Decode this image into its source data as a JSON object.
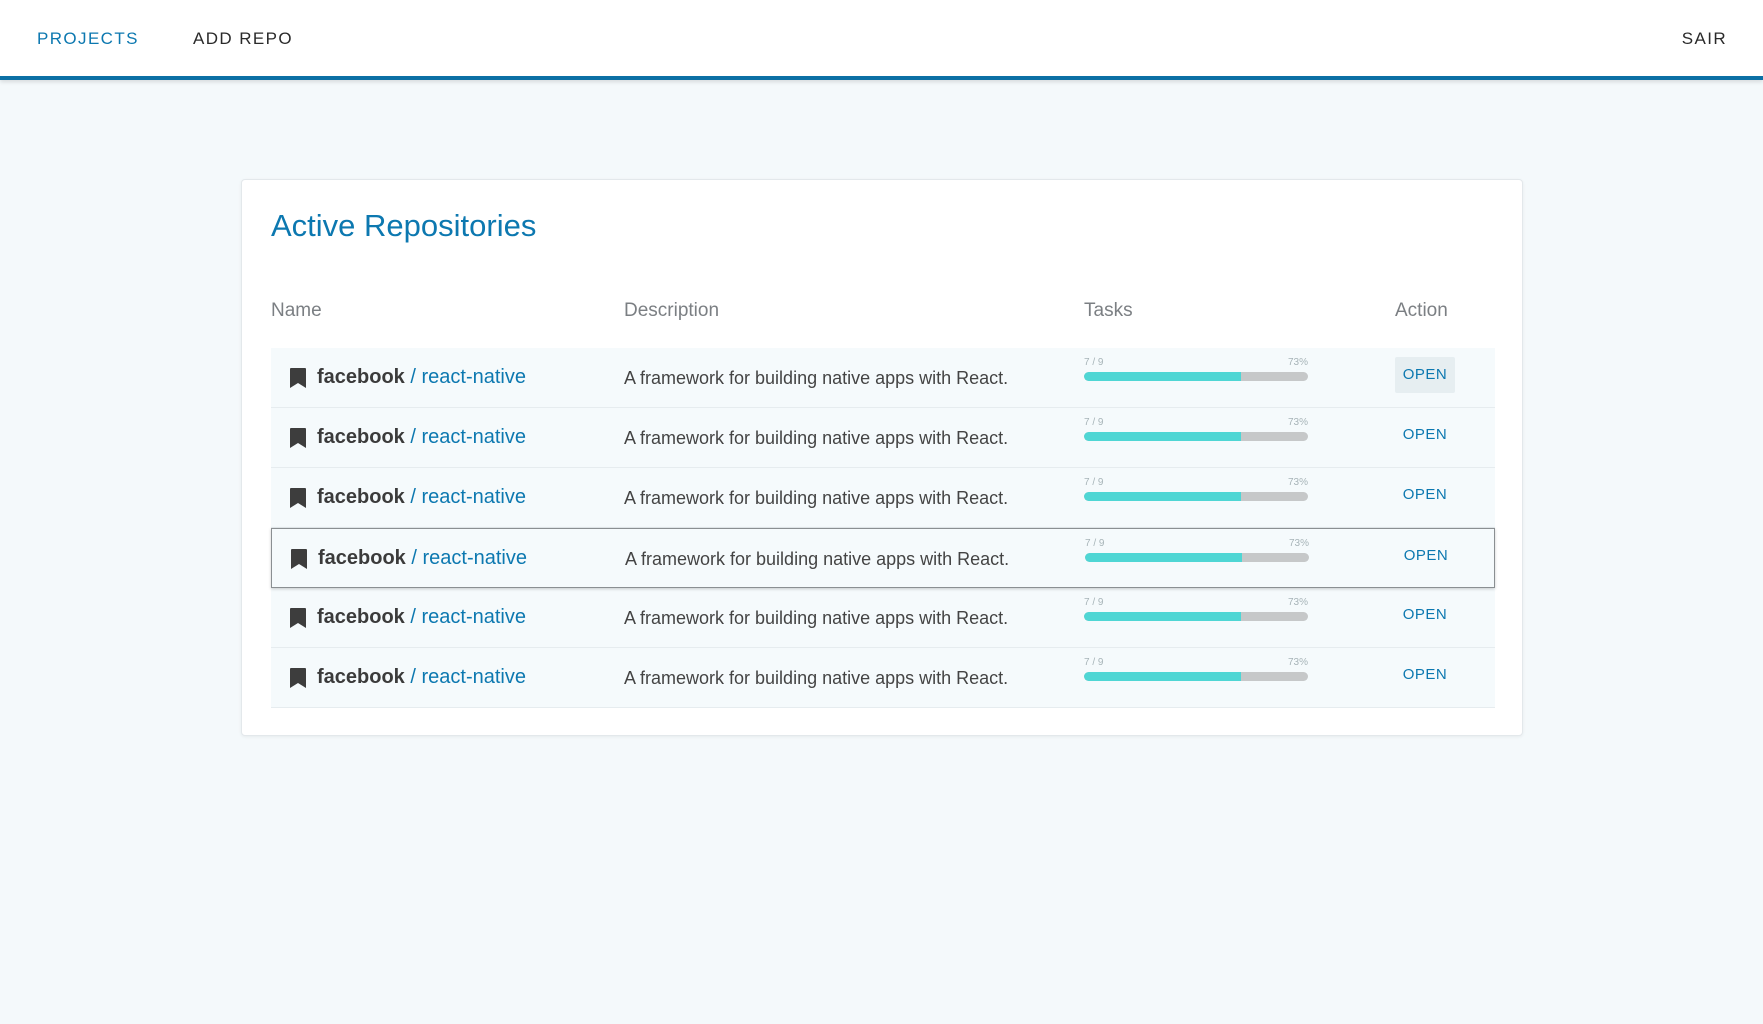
{
  "nav": {
    "projects": "PROJECTS",
    "add_repo": "ADD REPO",
    "logout": "SAIR",
    "accent_color": "#0c78b0"
  },
  "card": {
    "title": "Active Repositories",
    "columns": {
      "name": "Name",
      "description": "Description",
      "tasks": "Tasks",
      "action": "Action"
    }
  },
  "rows": [
    {
      "owner": "facebook",
      "separator": "/",
      "project": "react-native",
      "description": "A framework for building native apps with React.",
      "tasks_count": "7 / 9",
      "tasks_percent": "73%",
      "progress": 0.7,
      "action": "OPEN",
      "icon": "bookmark-icon"
    },
    {
      "owner": "facebook",
      "separator": "/",
      "project": "react-native",
      "description": "A framework for building native apps with React.",
      "tasks_count": "7 / 9",
      "tasks_percent": "73%",
      "progress": 0.7,
      "action": "OPEN",
      "icon": "bookmark-icon"
    },
    {
      "owner": "facebook",
      "separator": "/",
      "project": "react-native",
      "description": "A framework for building native apps with React.",
      "tasks_count": "7 / 9",
      "tasks_percent": "73%",
      "progress": 0.7,
      "action": "OPEN",
      "icon": "bookmark-icon"
    },
    {
      "owner": "facebook",
      "separator": "/",
      "project": "react-native",
      "description": "A framework for building native apps with React.",
      "tasks_count": "7 / 9",
      "tasks_percent": "73%",
      "progress": 0.7,
      "action": "OPEN",
      "icon": "bookmark-icon"
    },
    {
      "owner": "facebook",
      "separator": "/",
      "project": "react-native",
      "description": "A framework for building native apps with React.",
      "tasks_count": "7 / 9",
      "tasks_percent": "73%",
      "progress": 0.7,
      "action": "OPEN",
      "icon": "bookmark-icon"
    },
    {
      "owner": "facebook",
      "separator": "/",
      "project": "react-native",
      "description": "A framework for building native apps with React.",
      "tasks_count": "7 / 9",
      "tasks_percent": "73%",
      "progress": 0.7,
      "action": "OPEN",
      "icon": "bookmark-icon"
    }
  ],
  "colors": {
    "progress_fill": "#4fd6d4",
    "progress_track": "#c6c8c9"
  }
}
